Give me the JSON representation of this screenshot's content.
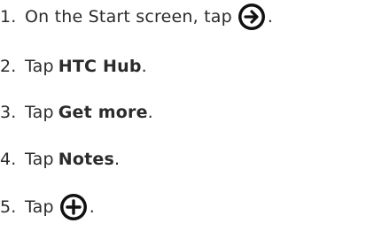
{
  "steps": [
    {
      "number": "1.",
      "text": "On the Start screen, tap",
      "icon": "arrow-right-circle-icon",
      "suffix": "."
    },
    {
      "number": "2.",
      "text": "Tap",
      "bold": "HTC Hub",
      "suffix": "."
    },
    {
      "number": "3.",
      "text": "Tap",
      "bold": "Get more",
      "suffix": "."
    },
    {
      "number": "4.",
      "text": "Tap",
      "bold": "Notes",
      "suffix": "."
    },
    {
      "number": "5.",
      "text": "Tap",
      "icon": "plus-circle-icon",
      "suffix": "."
    }
  ],
  "icon_color": "#111111"
}
